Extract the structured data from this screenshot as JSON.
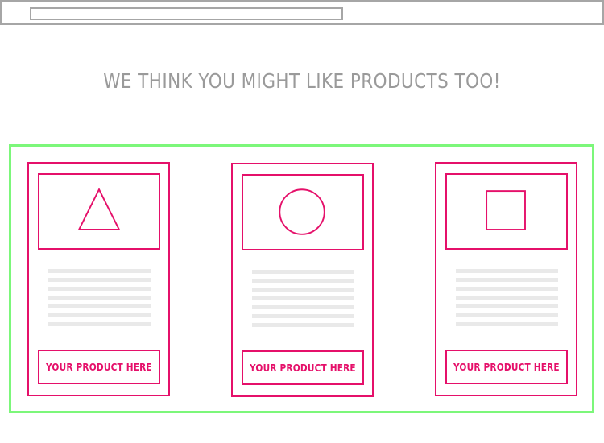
{
  "browser": {
    "url": ""
  },
  "section": {
    "heading": "WE THINK YOU MIGHT LIKE PRODUCTS TOO!"
  },
  "colors": {
    "accent": "#e5106a",
    "container_border": "#7cf77a",
    "text_gray": "#9a9a9a",
    "placeholder_line": "#e9e9e9"
  },
  "products": [
    {
      "shape": "triangle-icon",
      "button_label": "YOUR PRODUCT HERE"
    },
    {
      "shape": "circle-icon",
      "button_label": "YOUR PRODUCT HERE"
    },
    {
      "shape": "square-icon",
      "button_label": "YOUR PRODUCT HERE"
    }
  ]
}
